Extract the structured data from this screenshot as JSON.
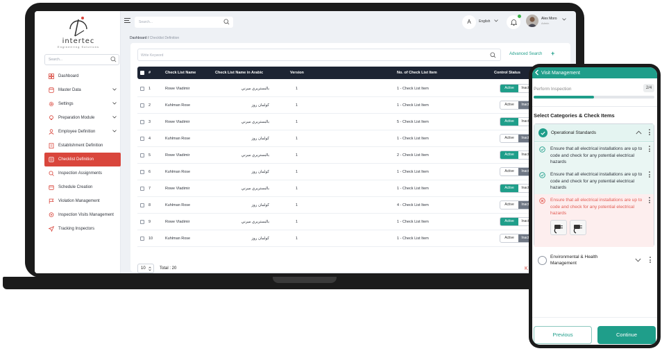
{
  "brand": {
    "name": "intertec",
    "tagline": "Engineering Solutions"
  },
  "sidebar": {
    "search_placeholder": "Search...",
    "items": [
      {
        "label": "Dashboard",
        "icon": "dashboard-icon",
        "expandable": false,
        "active": false
      },
      {
        "label": "Master Data",
        "icon": "database-icon",
        "expandable": true,
        "active": false
      },
      {
        "label": "Settings",
        "icon": "gear-icon",
        "expandable": true,
        "active": false
      },
      {
        "label": "Preparation Module",
        "icon": "lightbulb-icon",
        "expandable": true,
        "active": false
      },
      {
        "label": "Employee Definition",
        "icon": "user-icon",
        "expandable": true,
        "active": false
      },
      {
        "label": "Establishment Definition",
        "icon": "building-icon",
        "expandable": false,
        "active": false
      },
      {
        "label": "Checklist Definition",
        "icon": "checklist-icon",
        "expandable": false,
        "active": true
      },
      {
        "label": "Inspection Assignments",
        "icon": "assignment-icon",
        "expandable": false,
        "active": false
      },
      {
        "label": "Schedule Creation",
        "icon": "calendar-icon",
        "expandable": false,
        "active": false
      },
      {
        "label": "Violation Management",
        "icon": "flag-icon",
        "expandable": false,
        "active": false
      },
      {
        "label": "Inspection Visits Management",
        "icon": "location-icon",
        "expandable": false,
        "active": false
      },
      {
        "label": "Tracking Inspectors",
        "icon": "navigation-icon",
        "expandable": false,
        "active": false
      }
    ]
  },
  "topbar": {
    "search_placeholder": "Search...",
    "lang_initial": "A",
    "lang_label": "English",
    "user_name": "Alex Moro",
    "user_role": "Admin"
  },
  "breadcrumb": {
    "root": "Dashboard",
    "separator": " / ",
    "current": "Checklist Definition"
  },
  "filter": {
    "placeholder": "Write Keyword",
    "advanced_label": "Advanced Search",
    "advanced_plus": "+"
  },
  "table": {
    "headers": {
      "num": "#",
      "name": "Check List Name",
      "name_ar": "Check List Name in Arabic",
      "version": "Version",
      "items": "No. of Check List Item",
      "status": "Control Status"
    },
    "toggle_labels": {
      "on": "Active",
      "off": "Inactive"
    },
    "rows": [
      {
        "num": "1",
        "name": "Rowe Vladimir",
        "name_ar": "بالبستريري ميرني",
        "version": "1",
        "items": "1 - Check List Item",
        "status": "active"
      },
      {
        "num": "2",
        "name": "Kuhlman Rose",
        "name_ar": "كولمان روز",
        "version": "1",
        "items": "1 - Check List Item",
        "status": "inactive"
      },
      {
        "num": "3",
        "name": "Rowe Vladimir",
        "name_ar": "بالبستريري ميرني",
        "version": "1",
        "items": "5 - Check List Item",
        "status": "active"
      },
      {
        "num": "4",
        "name": "Kuhlman Rose",
        "name_ar": "كولمان روز",
        "version": "1",
        "items": "1 - Check List Item",
        "status": "inactive"
      },
      {
        "num": "5",
        "name": "Rowe Vladimir",
        "name_ar": "بالبستريري ميرني",
        "version": "1",
        "items": "2 - Check List Item",
        "status": "active"
      },
      {
        "num": "6",
        "name": "Kuhlman Rose",
        "name_ar": "كولمان روز",
        "version": "1",
        "items": "1 - Check List Item",
        "status": "inactive"
      },
      {
        "num": "7",
        "name": "Rowe Vladimir",
        "name_ar": "بالبستريري ميرني",
        "version": "1",
        "items": "1 - Check List Item",
        "status": "active"
      },
      {
        "num": "8",
        "name": "Kuhlman Rose",
        "name_ar": "كولمان روز",
        "version": "1",
        "items": "4 - Check List Item",
        "status": "inactive"
      },
      {
        "num": "9",
        "name": "Rowe Vladimir",
        "name_ar": "بالبستريري ميرني",
        "version": "1",
        "items": "1 - Check List Item",
        "status": "active"
      },
      {
        "num": "10",
        "name": "Kuhlman Rose",
        "name_ar": "كولمان روز",
        "version": "1",
        "items": "1 - Check List Item",
        "status": "inactive"
      }
    ]
  },
  "pager": {
    "page_size": "10",
    "total": "Total : 20",
    "prev_symbol": "K <"
  },
  "mobile": {
    "header_title": "Visit Management",
    "step_label": "Perform Inspection",
    "step_count": "2/4",
    "progress": 0.5,
    "section_title": "Select  Categories & Check Items",
    "category_1": "Operational Standards",
    "items": [
      {
        "text": "Ensure that all electrical installations are up to code and check for any potential electrical hazards",
        "state": "ok"
      },
      {
        "text": "Ensure that all electrical installations are up to code and check for any potential electrical hazards",
        "state": "ok"
      },
      {
        "text": "Ensure that all electrical installations are up to code and check for any potential electrical hazards",
        "state": "bad"
      }
    ],
    "category_2": "Environmental & Health Management",
    "prev_label": "Previous",
    "next_label": "Continue"
  },
  "colors": {
    "accent": "#1f9e8a",
    "danger": "#d9463c",
    "header_dark": "#1d2433"
  }
}
